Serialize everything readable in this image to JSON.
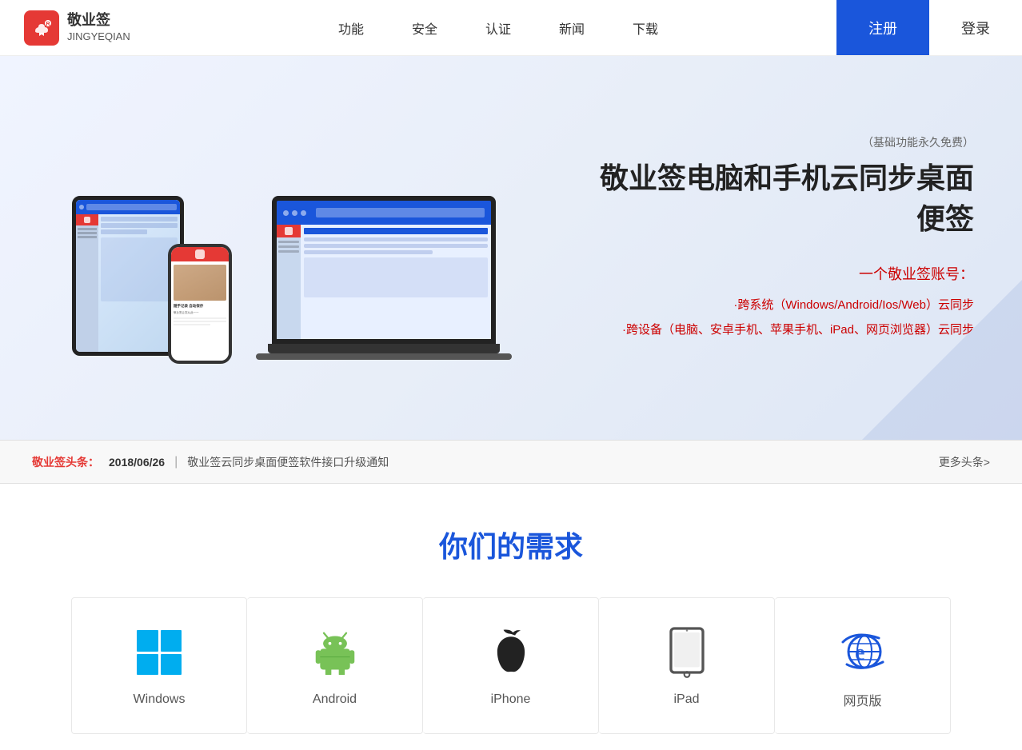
{
  "header": {
    "logo_brand": "敬业签",
    "logo_subtitle": "JINGYEQIAN",
    "nav": {
      "items": [
        {
          "label": "功能",
          "href": "#"
        },
        {
          "label": "安全",
          "href": "#"
        },
        {
          "label": "认证",
          "href": "#"
        },
        {
          "label": "新闻",
          "href": "#"
        },
        {
          "label": "下载",
          "href": "#"
        }
      ]
    },
    "register_label": "注册",
    "login_label": "登录"
  },
  "hero": {
    "subtitle": "（基础功能永久免费）",
    "title": "敬业签电脑和手机云同步桌面便签",
    "account_title": "一个敬业签账号：",
    "feature1": "·跨系统（Windows/Android/Ios/Web）云同步",
    "feature2": "·跨设备（电脑、安卓手机、苹果手机、iPad、网页浏览器）云同步"
  },
  "news": {
    "label": "敬业签头条：",
    "date": "2018/06/26",
    "content": "敬业签云同步桌面便签软件接口升级通知",
    "more": "更多头条>"
  },
  "needs": {
    "title": "你们的需求"
  },
  "platforms": [
    {
      "id": "windows",
      "label": "Windows",
      "icon_type": "windows"
    },
    {
      "id": "android",
      "label": "Android",
      "icon_type": "android"
    },
    {
      "id": "iphone",
      "label": "iPhone",
      "icon_type": "apple"
    },
    {
      "id": "ipad",
      "label": "iPad",
      "icon_type": "ipad"
    },
    {
      "id": "web",
      "label": "网页版",
      "icon_type": "ie"
    }
  ]
}
